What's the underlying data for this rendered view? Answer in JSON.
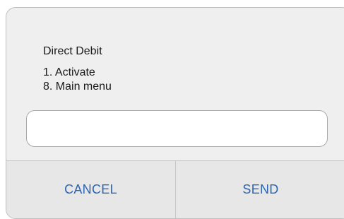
{
  "dialog": {
    "title": "Direct Debit",
    "options": [
      "1. Activate",
      "8. Main menu"
    ],
    "reply_input": {
      "value": "",
      "placeholder": ""
    },
    "buttons": {
      "cancel_label": "CANCEL",
      "send_label": "SEND"
    }
  },
  "colors": {
    "dialog_background": "#efefef",
    "button_text": "#2a66b3",
    "border": "#bdbdbd"
  }
}
